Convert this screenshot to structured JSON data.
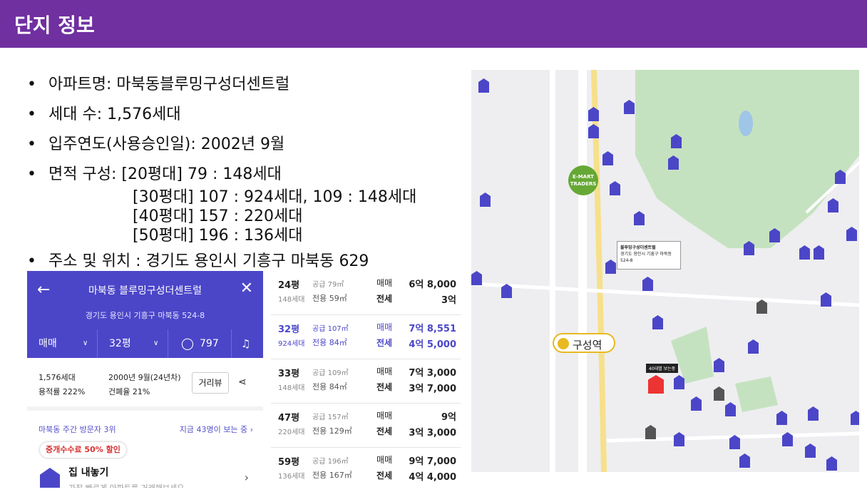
{
  "slide": {
    "title": "단지 정보"
  },
  "bullets": [
    "아파트명: 마북동블루밍구성더센트럴",
    "세대 수: 1,576세대",
    "입주연도(사용승인일): 2002년  9월",
    "면적 구성:  [20평대]   79 : 148세대",
    "주소  및 위치 : 경기도 용인시 기흥구 마북동 629"
  ],
  "area_sublines": [
    "[30평대] 107 : 924세대,  109 : 148세대",
    "[40평대] 157 : 220세대",
    "[50평대] 196 : 136세대"
  ],
  "app": {
    "title": "마북동 블루밍구성더센트럴",
    "address": "경기도 용인시 기흥구 마북동 524-8",
    "trade_type": "매매",
    "size": "32평",
    "comment_count": "797",
    "households": "1,576세대",
    "floor_area_ratio": "용적률 222%",
    "completion": "2000년 9월(24년차)",
    "coverage_ratio": "건폐율 21%",
    "road_view": "거리뷰",
    "visitors_left": "마북동 주간 방문자 3위",
    "visitors_right": "지금 43명이 보는 중 ›",
    "coupon": "중개수수료 50% 할인",
    "home_title": "집 내놓기",
    "home_sub": "가장 빠르게 아파트를 거래해보세요"
  },
  "price_rows": [
    {
      "pyeong": "24평",
      "supply": "공급 79㎡",
      "units": "148세대",
      "exclusive": "전용 59㎡",
      "sale_label": "매매",
      "jeonse_label": "전세",
      "sale": "6억 8,000",
      "jeonse": "3억",
      "highlight": false
    },
    {
      "pyeong": "32평",
      "supply": "공급 107㎡",
      "units": "924세대",
      "exclusive": "전용 84㎡",
      "sale_label": "매매",
      "jeonse_label": "전세",
      "sale": "7억 8,551",
      "jeonse": "4억 5,000",
      "highlight": true
    },
    {
      "pyeong": "33평",
      "supply": "공급 109㎡",
      "units": "148세대",
      "exclusive": "전용 84㎡",
      "sale_label": "매매",
      "jeonse_label": "전세",
      "sale": "7억 3,000",
      "jeonse": "3억 7,000",
      "highlight": false
    },
    {
      "pyeong": "47평",
      "supply": "공급 157㎡",
      "units": "220세대",
      "exclusive": "전용 129㎡",
      "sale_label": "매매",
      "jeonse_label": "전세",
      "sale": "9억",
      "jeonse": "3억 3,000",
      "highlight": false
    },
    {
      "pyeong": "59평",
      "supply": "공급 196㎡",
      "units": "136세대",
      "exclusive": "전용 167㎡",
      "sale_label": "매매",
      "jeonse_label": "전세",
      "sale": "9억 7,000",
      "jeonse": "4억 4,000",
      "highlight": false
    }
  ],
  "map": {
    "station_label": "구성역",
    "emart_label": "E-MART TRADERS",
    "callout_title": "블루밍구성더센트럴",
    "callout_addr": "경기도 용인시 기흥구 마북동 524-8",
    "tag_40": "40대별 보는중",
    "colors": {
      "pin": "#4b46c8",
      "park": "#c5e2c0",
      "road": "#f6e08a"
    }
  }
}
